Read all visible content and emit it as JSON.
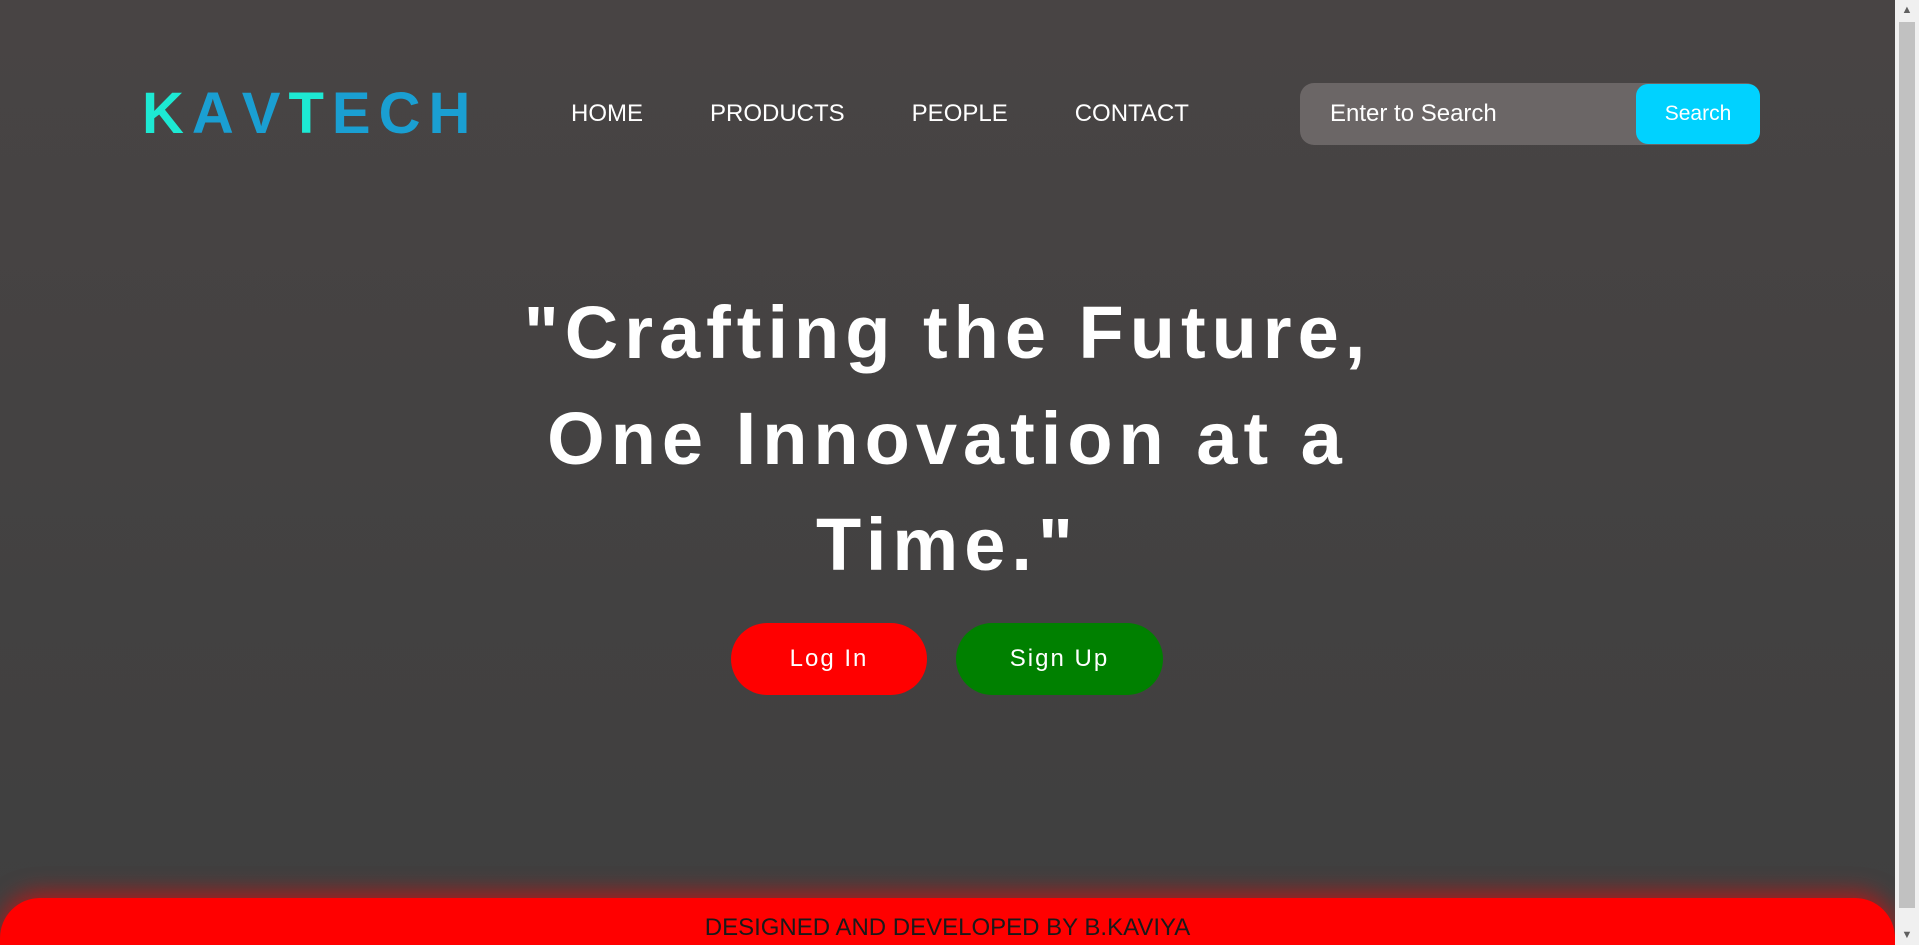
{
  "brand": {
    "letters": [
      {
        "char": "K",
        "color": "#1de9d3"
      },
      {
        "char": "A",
        "color": "#1a9fd2"
      },
      {
        "char": "V",
        "color": "#1a9fd2"
      },
      {
        "char": "T",
        "color": "#1de9d3"
      },
      {
        "char": "E",
        "color": "#1a9fd2"
      },
      {
        "char": "C",
        "color": "#1a9fd2"
      },
      {
        "char": "H",
        "color": "#1a9fd2"
      }
    ]
  },
  "nav": {
    "items": [
      "HOME",
      "PRODUCTS",
      "PEOPLE",
      "CONTACT"
    ]
  },
  "search": {
    "placeholder": "Enter to Search",
    "button_label": "Search",
    "button_color": "#00d2ff"
  },
  "hero": {
    "tagline": "\"Crafting the Future, One Innovation at a Time.\""
  },
  "actions": {
    "login_label": "Log In",
    "login_color": "#ff0000",
    "signup_label": "Sign Up",
    "signup_color": "#008000"
  },
  "footer": {
    "credit": "DESIGNED AND DEVELOPED BY B.KAVIYA",
    "color": "#ff0000"
  },
  "scrollbar": {
    "up_icon": "triangle-up-icon",
    "down_icon": "triangle-down-icon"
  }
}
